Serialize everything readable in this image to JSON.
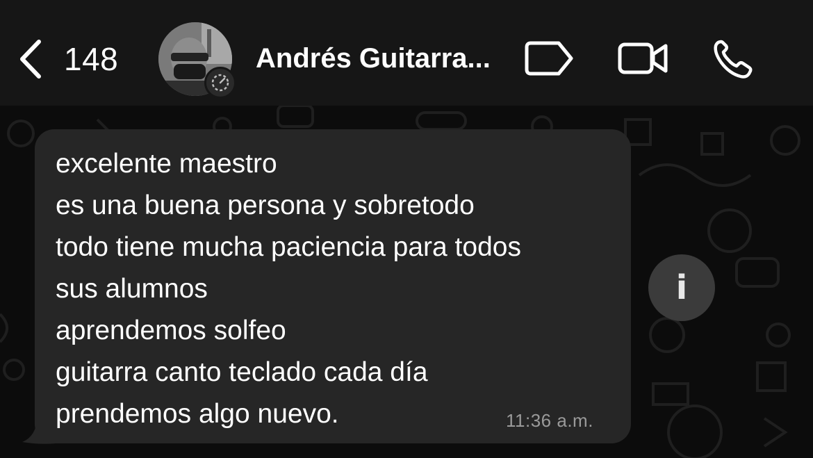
{
  "header": {
    "back_count": "148",
    "contact_name": "Andrés Guitarra...",
    "icons": [
      "chevron-left-icon",
      "tag-icon",
      "video-camera-icon",
      "phone-icon"
    ]
  },
  "message": {
    "lines": [
      "excelente maestro",
      "es una buena persona y sobretodo",
      "todo tiene mucha paciencia para todos",
      "sus alumnos",
      "aprendemos solfeo",
      "guitarra canto teclado cada día",
      "prendemos algo nuevo."
    ],
    "time": "11:36 a.m."
  },
  "info_button": {
    "label": "i"
  },
  "colors": {
    "header_bg": "#161616",
    "chat_bg": "#0c0c0c",
    "bubble_bg": "#262626",
    "timestamp": "#9a9a9a"
  }
}
